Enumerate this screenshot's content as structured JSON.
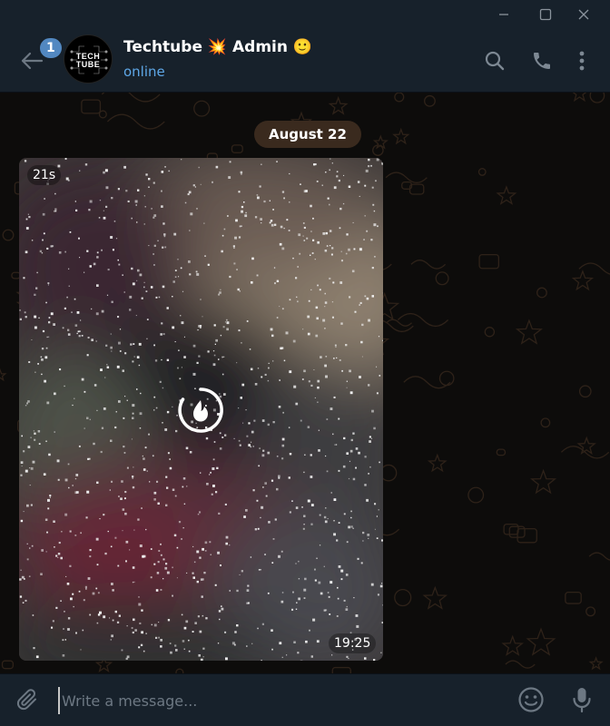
{
  "window": {
    "controls": [
      "minimize-icon",
      "maximize-icon",
      "close-icon"
    ]
  },
  "header": {
    "unread_count": "1",
    "avatar_text_line1": "TECH",
    "avatar_text_line2": "TUBE",
    "title_part1": "Techtube",
    "title_emoji1": "💥",
    "title_part2": "Admin",
    "title_emoji2": "🙂",
    "status": "online",
    "icons": [
      "back-arrow-icon",
      "search-icon",
      "phone-icon",
      "more-vertical-icon"
    ]
  },
  "chat": {
    "date_label": "August 22",
    "video_message": {
      "duration": "21s",
      "time": "19:25",
      "overlay_icon": "view-once-fire-icon"
    }
  },
  "composer": {
    "placeholder": "Write a message...",
    "icons": [
      "paperclip-icon",
      "emoji-smile-icon",
      "microphone-icon"
    ]
  },
  "colors": {
    "window_bg": "#17212b",
    "accent_blue": "#5288c1",
    "status_blue": "#5ea7e7",
    "date_pill": "#3a2a1e",
    "chat_bg": "#0d0c0b"
  }
}
